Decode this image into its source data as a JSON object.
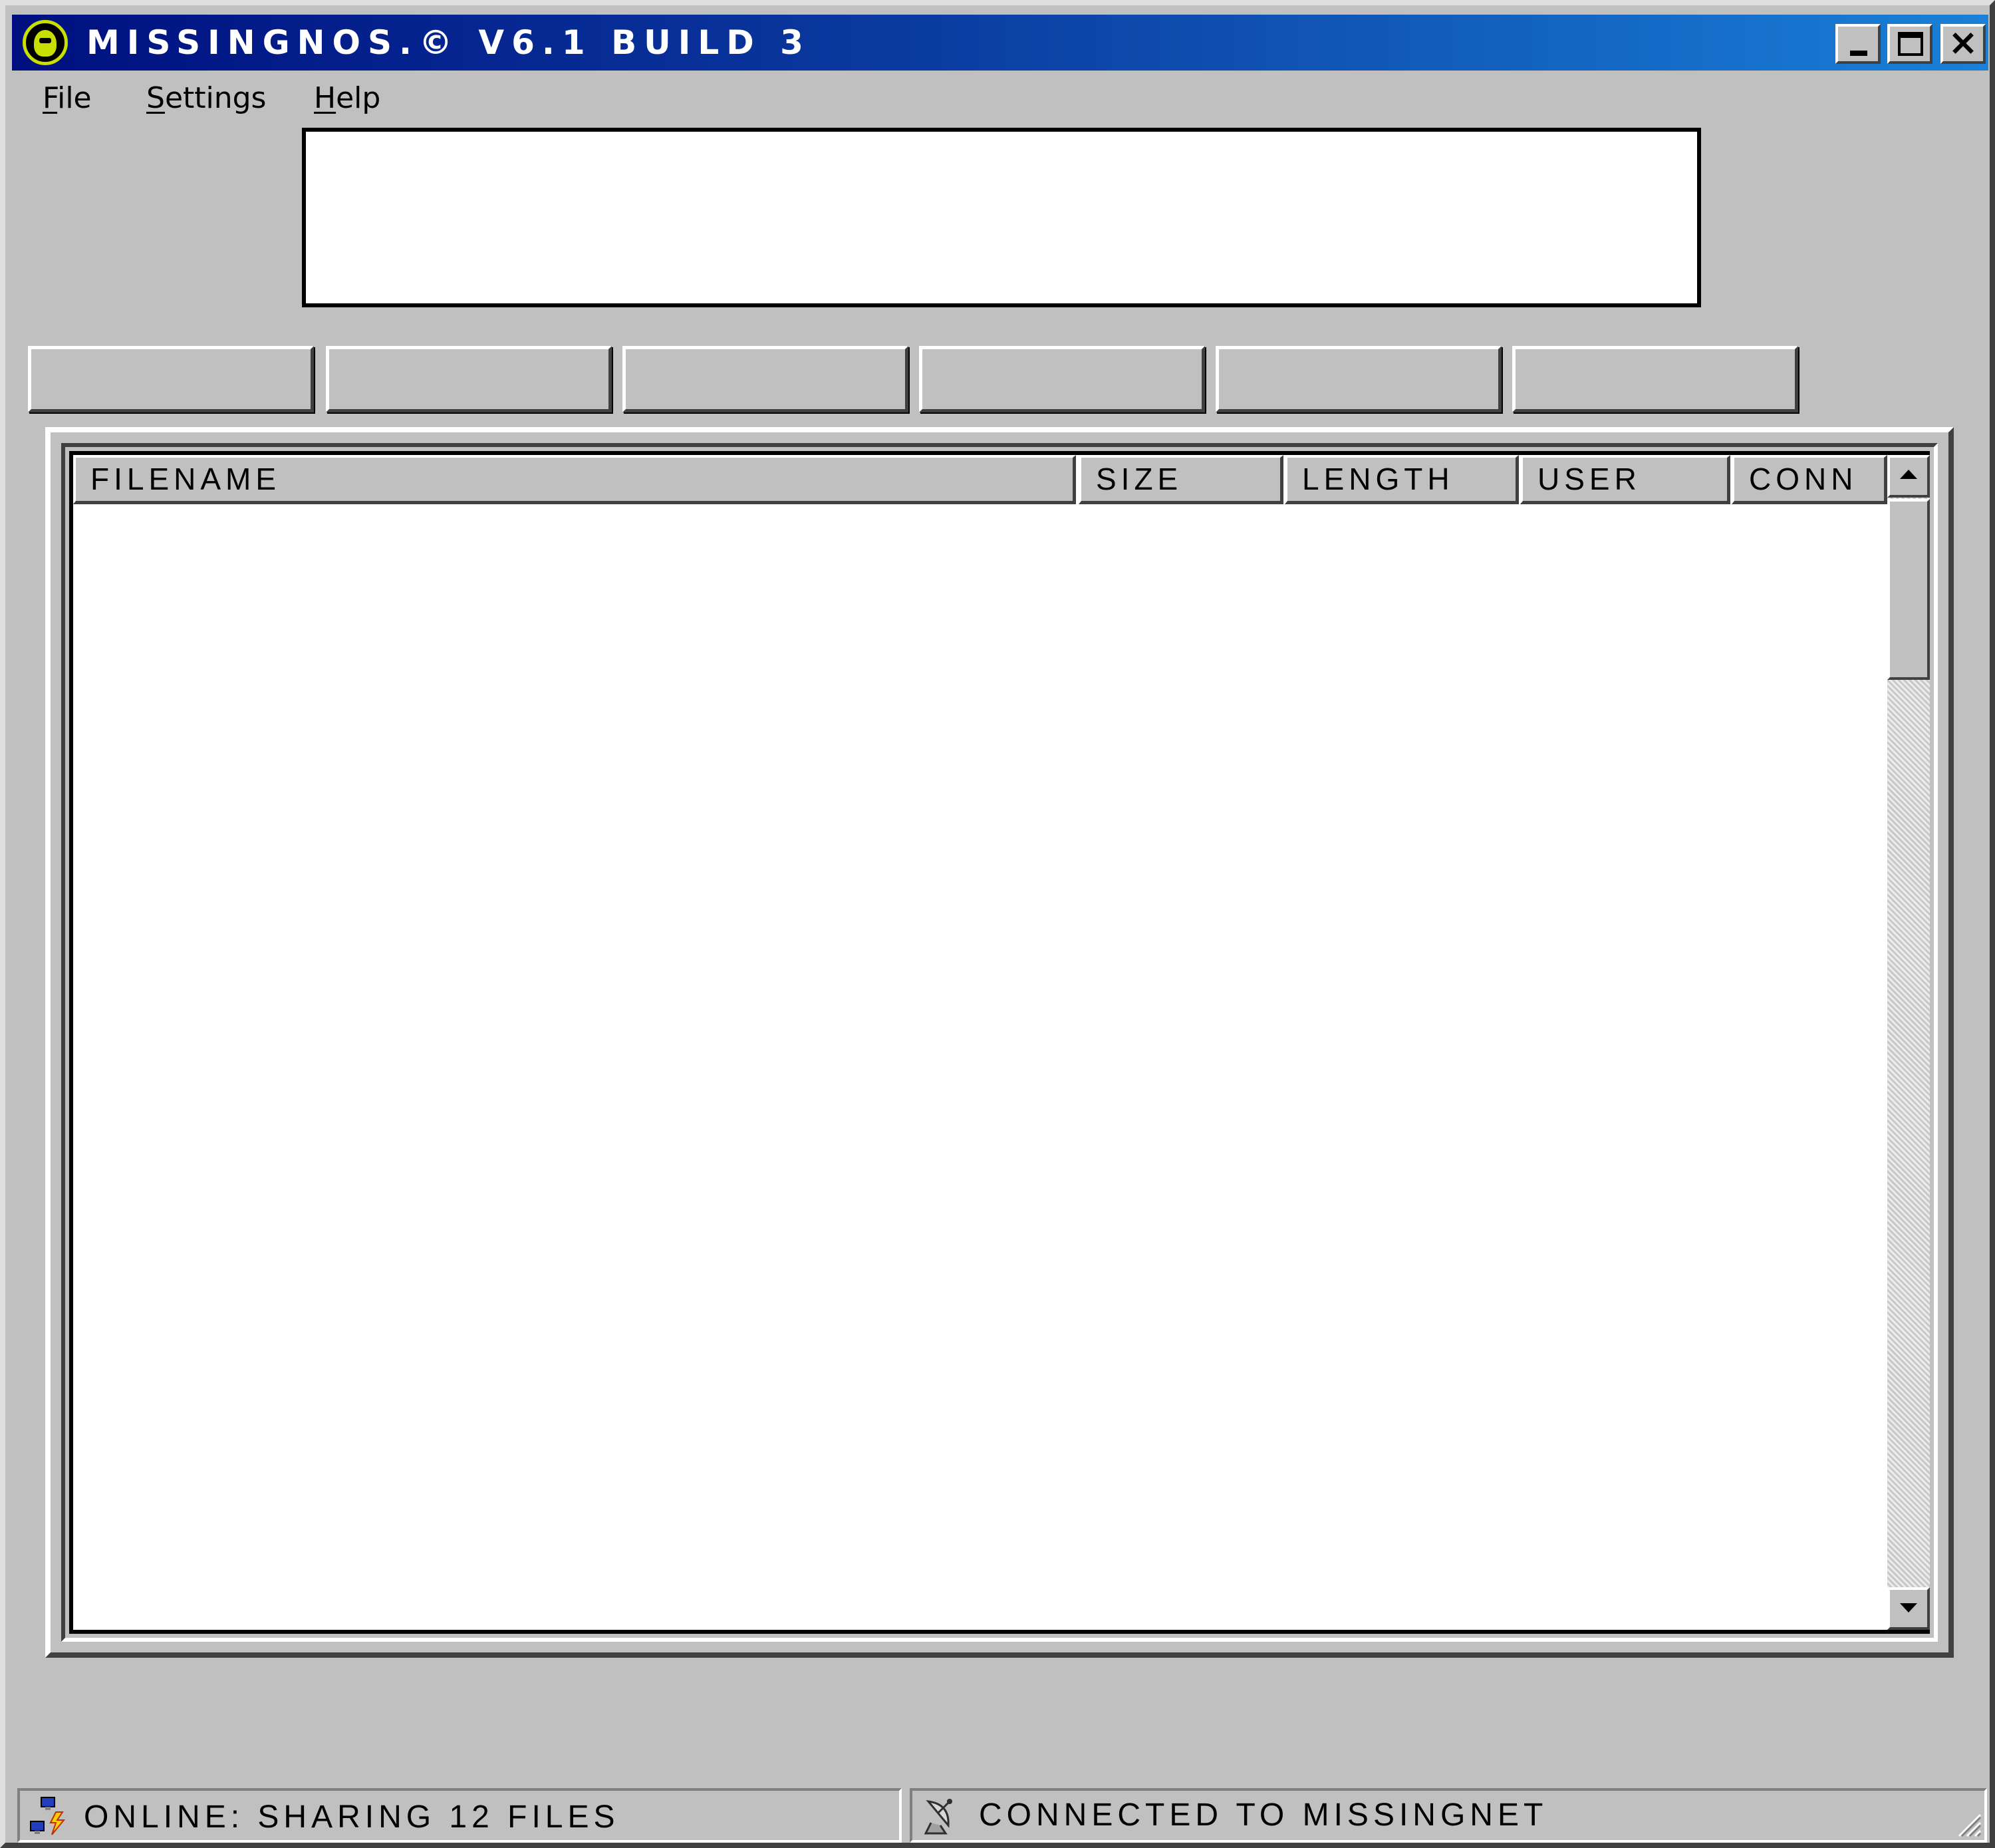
{
  "window": {
    "title": "MISSINGNOS.© V6.1  BUILD 3"
  },
  "menu": {
    "items": [
      {
        "accel": "F",
        "rest": "ile"
      },
      {
        "accel": "S",
        "rest": "ettings"
      },
      {
        "accel": "H",
        "rest": "elp"
      }
    ]
  },
  "table": {
    "columns": [
      "FILENAME",
      "SIZE",
      "LENGTH",
      "USER",
      "CONN"
    ],
    "rows": []
  },
  "status": {
    "left": "ONLINE: SHARING 12 FILES",
    "right": "CONNECTED TO MISSINGNET"
  },
  "icons": {
    "app": "missingnos-logo-icon",
    "minimize": "minimize-icon",
    "maximize": "maximize-icon",
    "close": "close-icon",
    "network": "network-computers-icon",
    "connection": "satellite-dish-icon"
  }
}
